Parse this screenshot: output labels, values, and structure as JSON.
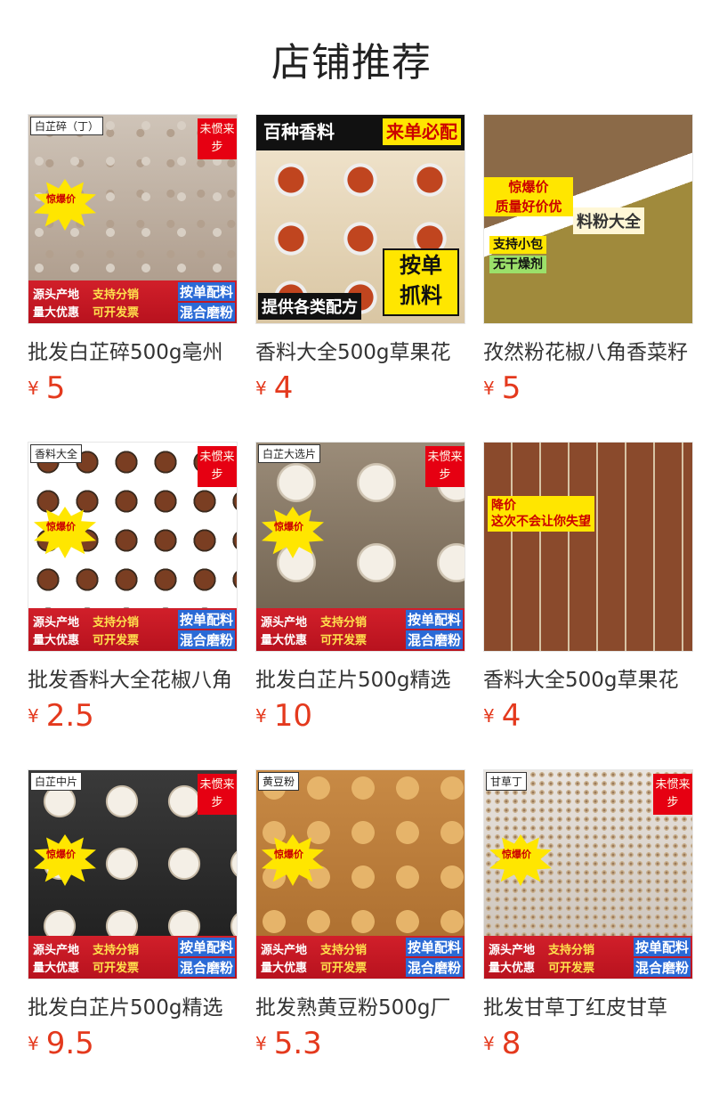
{
  "header": {
    "title": "店铺推荐"
  },
  "products": [
    {
      "name": "批发白芷碎500g亳州",
      "currency": "¥",
      "price": "5",
      "tag": "白芷碎（丁）",
      "style": "chips"
    },
    {
      "name": "香料大全500g草果花",
      "currency": "¥",
      "price": "4",
      "tag": "",
      "style": "spicebowls"
    },
    {
      "name": "孜然粉花椒八角香菜籽",
      "currency": "¥",
      "price": "5",
      "tag": "",
      "style": "powder"
    },
    {
      "name": "批发香料大全花椒八角",
      "currency": "¥",
      "price": "2.5",
      "tag": "香料大全",
      "style": "grid"
    },
    {
      "name": "批发白芷片500g精选",
      "currency": "¥",
      "price": "10",
      "tag": "白芷大选片",
      "style": "slices"
    },
    {
      "name": "香料大全500g草果花",
      "currency": "¥",
      "price": "4",
      "tag": "",
      "style": "catalog"
    },
    {
      "name": "批发白芷片500g精选",
      "currency": "¥",
      "price": "9.5",
      "tag": "白芷中片",
      "style": "slices2"
    },
    {
      "name": "批发熟黄豆粉500g厂",
      "currency": "¥",
      "price": "5.3",
      "tag": "黄豆粉",
      "style": "soy"
    },
    {
      "name": "批发甘草丁红皮甘草",
      "currency": "¥",
      "price": "8",
      "tag": "甘草丁",
      "style": "licorice"
    }
  ],
  "badges": {
    "corner": "未惯来步",
    "band_left_1": "源头产地",
    "band_left_2": "量大优惠",
    "band_mid_1": "支持分销",
    "band_mid_2": "可开发票",
    "band_right_1": "按单配料",
    "band_right_2": "混合磨粉",
    "burst": "惊爆价",
    "spice_top_left": "百种香料",
    "spice_top_right": "来单必配",
    "spice_big_1": "按单",
    "spice_big_2": "抓料",
    "spice_bottom": "提供各类配方",
    "powder_banner_1": "惊爆价",
    "powder_banner_2": "质量好价优",
    "powder_label": "料粉大全",
    "powder_support_1": "支持小包",
    "powder_support_2": "无干燥剂",
    "catalog_promo_1": "降价",
    "catalog_promo_2": "这次不会让你失望"
  },
  "colors": {
    "price": "#e4391d",
    "band": "#c8161f",
    "accent_yellow": "#ffe600"
  }
}
